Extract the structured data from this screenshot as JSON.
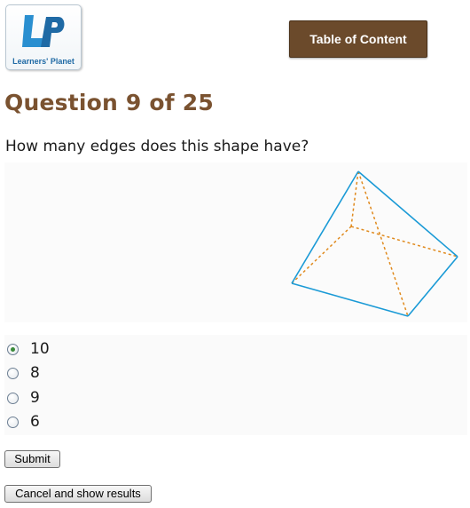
{
  "header": {
    "logo_text": "Learners' Planet",
    "logo_mark": "LP",
    "toc_button_label": "Table of Content"
  },
  "question": {
    "title": "Question 9 of 25",
    "text": "How many edges does this shape have?"
  },
  "figure": {
    "icon": "square-pyramid-wireframe",
    "solid_edge_color": "#1a9ad6",
    "hidden_edge_color": "#e08a1e"
  },
  "options": [
    {
      "label": "10",
      "selected": true
    },
    {
      "label": "8",
      "selected": false
    },
    {
      "label": "9",
      "selected": false
    },
    {
      "label": "6",
      "selected": false
    }
  ],
  "actions": {
    "submit_label": "Submit",
    "cancel_label": "Cancel and show results"
  },
  "colors": {
    "title": "#7a5230",
    "toc_button_bg": "#6b4a2b",
    "logo_blue": "#1f6aa5"
  }
}
